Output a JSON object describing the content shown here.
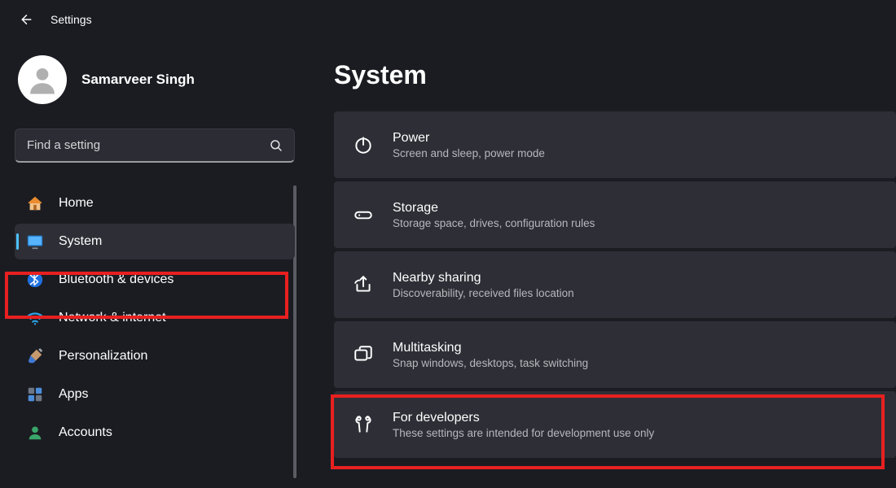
{
  "app": {
    "title": "Settings"
  },
  "profile": {
    "name": "Samarveer Singh"
  },
  "search": {
    "placeholder": "Find a setting"
  },
  "sidebar": {
    "items": [
      {
        "label": "Home"
      },
      {
        "label": "System"
      },
      {
        "label": "Bluetooth & devices"
      },
      {
        "label": "Network & internet"
      },
      {
        "label": "Personalization"
      },
      {
        "label": "Apps"
      },
      {
        "label": "Accounts"
      }
    ]
  },
  "page": {
    "title": "System"
  },
  "cards": [
    {
      "title": "Power",
      "subtitle": "Screen and sleep, power mode"
    },
    {
      "title": "Storage",
      "subtitle": "Storage space, drives, configuration rules"
    },
    {
      "title": "Nearby sharing",
      "subtitle": "Discoverability, received files location"
    },
    {
      "title": "Multitasking",
      "subtitle": "Snap windows, desktops, task switching"
    },
    {
      "title": "For developers",
      "subtitle": "These settings are intended for development use only"
    }
  ]
}
